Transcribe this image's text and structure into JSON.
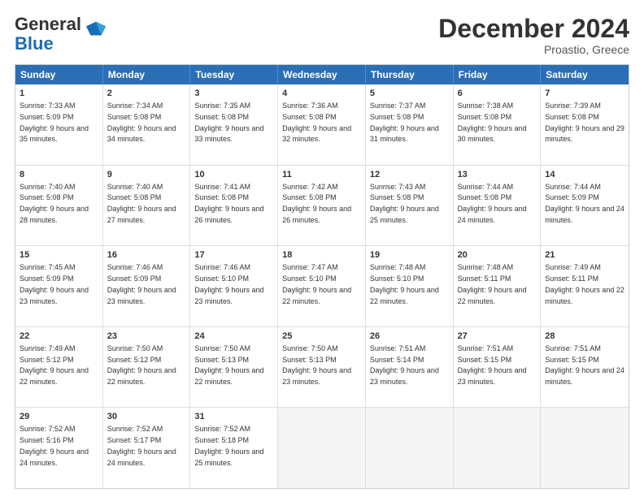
{
  "header": {
    "logo_line1": "General",
    "logo_line2": "Blue",
    "month": "December 2024",
    "location": "Proastio, Greece"
  },
  "days_of_week": [
    "Sunday",
    "Monday",
    "Tuesday",
    "Wednesday",
    "Thursday",
    "Friday",
    "Saturday"
  ],
  "weeks": [
    [
      {
        "day": "1",
        "sunrise": "Sunrise: 7:33 AM",
        "sunset": "Sunset: 5:09 PM",
        "daylight": "Daylight: 9 hours and 35 minutes."
      },
      {
        "day": "2",
        "sunrise": "Sunrise: 7:34 AM",
        "sunset": "Sunset: 5:08 PM",
        "daylight": "Daylight: 9 hours and 34 minutes."
      },
      {
        "day": "3",
        "sunrise": "Sunrise: 7:35 AM",
        "sunset": "Sunset: 5:08 PM",
        "daylight": "Daylight: 9 hours and 33 minutes."
      },
      {
        "day": "4",
        "sunrise": "Sunrise: 7:36 AM",
        "sunset": "Sunset: 5:08 PM",
        "daylight": "Daylight: 9 hours and 32 minutes."
      },
      {
        "day": "5",
        "sunrise": "Sunrise: 7:37 AM",
        "sunset": "Sunset: 5:08 PM",
        "daylight": "Daylight: 9 hours and 31 minutes."
      },
      {
        "day": "6",
        "sunrise": "Sunrise: 7:38 AM",
        "sunset": "Sunset: 5:08 PM",
        "daylight": "Daylight: 9 hours and 30 minutes."
      },
      {
        "day": "7",
        "sunrise": "Sunrise: 7:39 AM",
        "sunset": "Sunset: 5:08 PM",
        "daylight": "Daylight: 9 hours and 29 minutes."
      }
    ],
    [
      {
        "day": "8",
        "sunrise": "Sunrise: 7:40 AM",
        "sunset": "Sunset: 5:08 PM",
        "daylight": "Daylight: 9 hours and 28 minutes."
      },
      {
        "day": "9",
        "sunrise": "Sunrise: 7:40 AM",
        "sunset": "Sunset: 5:08 PM",
        "daylight": "Daylight: 9 hours and 27 minutes."
      },
      {
        "day": "10",
        "sunrise": "Sunrise: 7:41 AM",
        "sunset": "Sunset: 5:08 PM",
        "daylight": "Daylight: 9 hours and 26 minutes."
      },
      {
        "day": "11",
        "sunrise": "Sunrise: 7:42 AM",
        "sunset": "Sunset: 5:08 PM",
        "daylight": "Daylight: 9 hours and 26 minutes."
      },
      {
        "day": "12",
        "sunrise": "Sunrise: 7:43 AM",
        "sunset": "Sunset: 5:08 PM",
        "daylight": "Daylight: 9 hours and 25 minutes."
      },
      {
        "day": "13",
        "sunrise": "Sunrise: 7:44 AM",
        "sunset": "Sunset: 5:08 PM",
        "daylight": "Daylight: 9 hours and 24 minutes."
      },
      {
        "day": "14",
        "sunrise": "Sunrise: 7:44 AM",
        "sunset": "Sunset: 5:09 PM",
        "daylight": "Daylight: 9 hours and 24 minutes."
      }
    ],
    [
      {
        "day": "15",
        "sunrise": "Sunrise: 7:45 AM",
        "sunset": "Sunset: 5:09 PM",
        "daylight": "Daylight: 9 hours and 23 minutes."
      },
      {
        "day": "16",
        "sunrise": "Sunrise: 7:46 AM",
        "sunset": "Sunset: 5:09 PM",
        "daylight": "Daylight: 9 hours and 23 minutes."
      },
      {
        "day": "17",
        "sunrise": "Sunrise: 7:46 AM",
        "sunset": "Sunset: 5:10 PM",
        "daylight": "Daylight: 9 hours and 23 minutes."
      },
      {
        "day": "18",
        "sunrise": "Sunrise: 7:47 AM",
        "sunset": "Sunset: 5:10 PM",
        "daylight": "Daylight: 9 hours and 22 minutes."
      },
      {
        "day": "19",
        "sunrise": "Sunrise: 7:48 AM",
        "sunset": "Sunset: 5:10 PM",
        "daylight": "Daylight: 9 hours and 22 minutes."
      },
      {
        "day": "20",
        "sunrise": "Sunrise: 7:48 AM",
        "sunset": "Sunset: 5:11 PM",
        "daylight": "Daylight: 9 hours and 22 minutes."
      },
      {
        "day": "21",
        "sunrise": "Sunrise: 7:49 AM",
        "sunset": "Sunset: 5:11 PM",
        "daylight": "Daylight: 9 hours and 22 minutes."
      }
    ],
    [
      {
        "day": "22",
        "sunrise": "Sunrise: 7:49 AM",
        "sunset": "Sunset: 5:12 PM",
        "daylight": "Daylight: 9 hours and 22 minutes."
      },
      {
        "day": "23",
        "sunrise": "Sunrise: 7:50 AM",
        "sunset": "Sunset: 5:12 PM",
        "daylight": "Daylight: 9 hours and 22 minutes."
      },
      {
        "day": "24",
        "sunrise": "Sunrise: 7:50 AM",
        "sunset": "Sunset: 5:13 PM",
        "daylight": "Daylight: 9 hours and 22 minutes."
      },
      {
        "day": "25",
        "sunrise": "Sunrise: 7:50 AM",
        "sunset": "Sunset: 5:13 PM",
        "daylight": "Daylight: 9 hours and 23 minutes."
      },
      {
        "day": "26",
        "sunrise": "Sunrise: 7:51 AM",
        "sunset": "Sunset: 5:14 PM",
        "daylight": "Daylight: 9 hours and 23 minutes."
      },
      {
        "day": "27",
        "sunrise": "Sunrise: 7:51 AM",
        "sunset": "Sunset: 5:15 PM",
        "daylight": "Daylight: 9 hours and 23 minutes."
      },
      {
        "day": "28",
        "sunrise": "Sunrise: 7:51 AM",
        "sunset": "Sunset: 5:15 PM",
        "daylight": "Daylight: 9 hours and 24 minutes."
      }
    ],
    [
      {
        "day": "29",
        "sunrise": "Sunrise: 7:52 AM",
        "sunset": "Sunset: 5:16 PM",
        "daylight": "Daylight: 9 hours and 24 minutes."
      },
      {
        "day": "30",
        "sunrise": "Sunrise: 7:52 AM",
        "sunset": "Sunset: 5:17 PM",
        "daylight": "Daylight: 9 hours and 24 minutes."
      },
      {
        "day": "31",
        "sunrise": "Sunrise: 7:52 AM",
        "sunset": "Sunset: 5:18 PM",
        "daylight": "Daylight: 9 hours and 25 minutes."
      },
      null,
      null,
      null,
      null
    ]
  ]
}
